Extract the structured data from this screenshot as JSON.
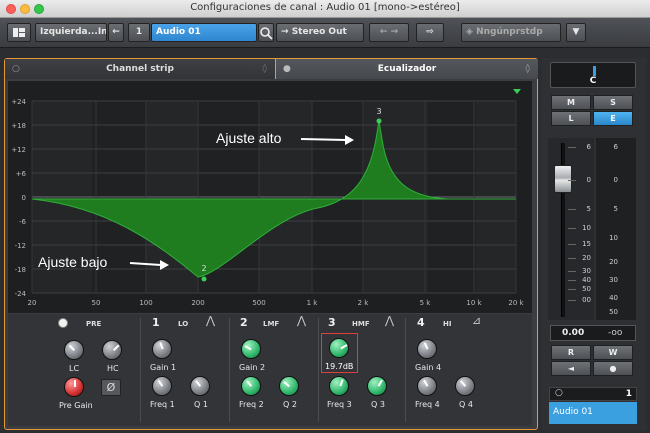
{
  "window": {
    "title": "Configuraciones de canal : Audio 01 [mono->estéreo]"
  },
  "toolbar": {
    "routing_left": "Izquierda...In",
    "channel_number": "1",
    "channel_name": "Audio 01",
    "output": "Stereo Out",
    "preset": "Nngúnprstdp"
  },
  "tabs": {
    "channel_strip": "Channel strip",
    "equalizer": "Ecualizador"
  },
  "eq": {
    "db_ticks": [
      "+24",
      "+18",
      "+12",
      "+6",
      "0",
      "-6",
      "-12",
      "-18",
      "-24"
    ],
    "freq_ticks": [
      "20",
      "50",
      "100",
      "200",
      "500",
      "1 k",
      "2 k",
      "5 k",
      "10 k",
      "20 k"
    ],
    "annotation_high": "Ajuste alto",
    "annotation_low": "Ajuste bajo",
    "point_high": "3",
    "point_low": "2",
    "curve_color": "#1f7d1f",
    "curve_edge": "#2fae3a"
  },
  "bands": {
    "pre": {
      "label": "PRE",
      "lc": "LC",
      "hc": "HC",
      "pre_gain": "Pre Gain"
    },
    "b1": {
      "num": "1",
      "type": "LO",
      "gain": "Gain 1",
      "freq": "Freq 1",
      "q": "Q 1"
    },
    "b2": {
      "num": "2",
      "type": "LMF",
      "gain": "Gain 2",
      "freq": "Freq 2",
      "q": "Q 2"
    },
    "b3": {
      "num": "3",
      "type": "HMF",
      "gain_value": "19.7dB",
      "freq": "Freq 3",
      "q": "Q 3"
    },
    "b4": {
      "num": "4",
      "type": "HI",
      "gain": "Gain 4",
      "freq": "Freq 4",
      "q": "Q 4"
    }
  },
  "right": {
    "pan": "C",
    "m": "M",
    "s": "S",
    "l": "L",
    "e": "E",
    "fader_scale_left": [
      "6",
      "0",
      "5",
      "10",
      "15",
      "20",
      "30",
      "40",
      "50",
      "00"
    ],
    "meter_scale_right": [
      "6",
      "0",
      "5",
      "10",
      "20",
      "30",
      "40",
      "50"
    ],
    "fader_value": "0.00",
    "peak_value": "-oo",
    "r": "R",
    "w": "W",
    "channel_number": "1",
    "channel_name": "Audio 01",
    "accent": "#3aa0e0"
  }
}
